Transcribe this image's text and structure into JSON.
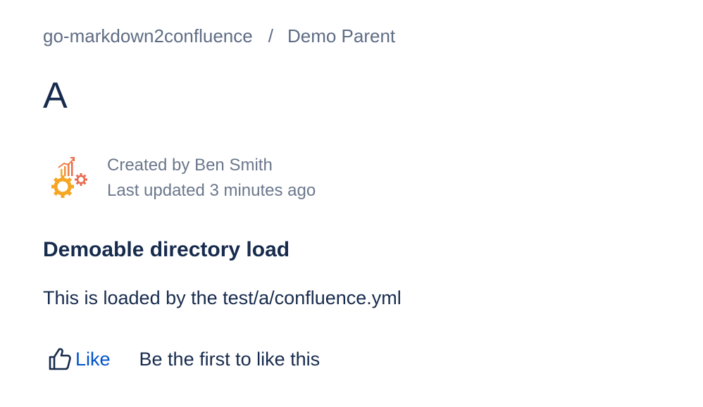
{
  "breadcrumb": {
    "items": [
      {
        "label": "go-markdown2confluence"
      },
      {
        "label": "Demo Parent"
      }
    ],
    "separator": "/"
  },
  "page": {
    "title": "A"
  },
  "byline": {
    "created": "Created by Ben Smith",
    "updated": "Last updated 3 minutes ago",
    "avatar_icon": "analytics-gears-icon"
  },
  "content": {
    "heading": "Demoable directory load",
    "paragraph": "This is loaded by the test/a/confluence.yml"
  },
  "likes": {
    "button_label": "Like",
    "summary": "Be the first to like this",
    "icon": "thumbs-up-icon"
  },
  "colors": {
    "link": "#0052cc",
    "text": "#172b4d",
    "muted": "#5e6c84",
    "avatar_orange": "#f5a623",
    "avatar_red": "#e86a4f"
  }
}
